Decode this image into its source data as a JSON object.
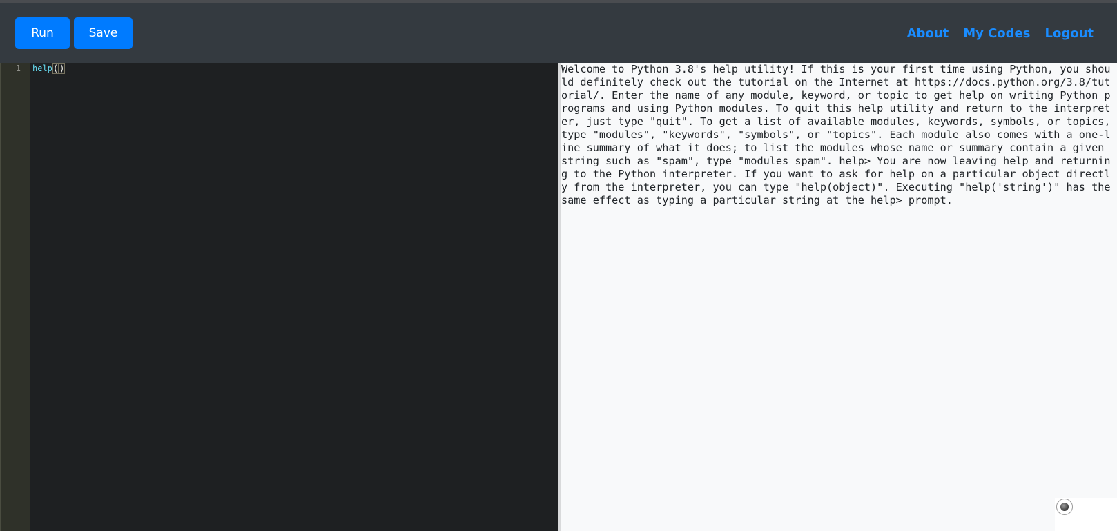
{
  "toolbar": {
    "run_label": "Run",
    "save_label": "Save"
  },
  "nav": {
    "links": [
      {
        "label": "About"
      },
      {
        "label": "My Codes"
      },
      {
        "label": "Logout"
      }
    ]
  },
  "editor": {
    "line_numbers": [
      "1"
    ],
    "code": {
      "function_name": "help",
      "open_paren": "(",
      "close_paren": ")"
    }
  },
  "output": {
    "text": "Welcome to Python 3.8's help utility! If this is your first time using Python, you should definitely check out the tutorial on the Internet at https://docs.python.org/3.8/tutorial/. Enter the name of any module, keyword, or topic to get help on writing Python programs and using Python modules. To quit this help utility and return to the interpreter, just type \"quit\". To get a list of available modules, keywords, symbols, or topics, type \"modules\", \"keywords\", \"symbols\", or \"topics\". Each module also comes with a one-line summary of what it does; to list the modules whose name or summary contain a given string such as \"spam\", type \"modules spam\". help> You are now leaving help and returning to the Python interpreter. If you want to ask for help on a particular object directly from the interpreter, you can type \"help(object)\". Executing \"help('string')\" has the same effect as typing a particular string at the help> prompt."
  },
  "colors": {
    "navbar_bg": "#343a40",
    "button_primary": "#007bff",
    "link": "#1a8cff",
    "editor_bg": "#1e2022",
    "gutter_bg": "#2f3129",
    "output_bg": "#f8f9fa"
  },
  "icons": {
    "widget": "record-circle-icon"
  }
}
